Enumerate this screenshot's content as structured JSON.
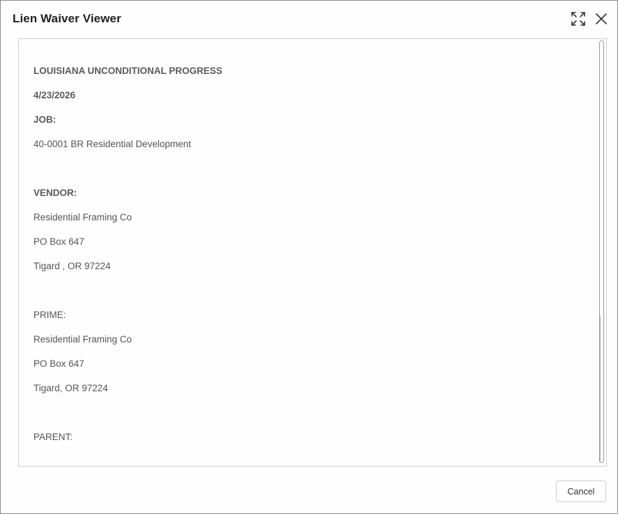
{
  "dialog": {
    "title": "Lien Waiver Viewer",
    "expand_icon": "expand-icon",
    "close_icon": "close-icon"
  },
  "document": {
    "heading": "LOUISIANA UNCONDITIONAL PROGRESS",
    "date": "4/23/2026",
    "job_label": "JOB:",
    "job_value": "40-0001 BR Residential Development",
    "vendor_label": "VENDOR:",
    "vendor_name": "Residential Framing Co",
    "vendor_address": "PO Box 647",
    "vendor_city": "Tigard , OR  97224",
    "prime_label": "PRIME:",
    "prime_name": "Residential Framing Co",
    "prime_address": "PO Box 647",
    "prime_city": "Tigard, OR   97224",
    "parent_label": "PARENT:"
  },
  "footer": {
    "cancel_label": "Cancel"
  }
}
